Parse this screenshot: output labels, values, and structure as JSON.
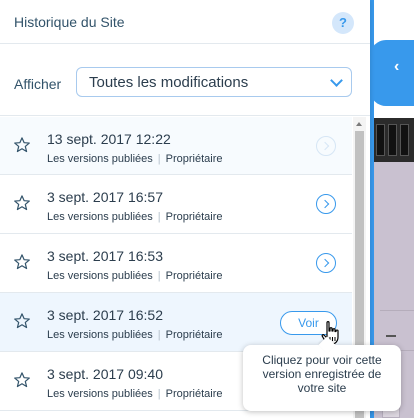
{
  "header": {
    "title": "Historique du Site",
    "help_label": "?"
  },
  "filter": {
    "label": "Afficher",
    "selected": "Toutes les modifications"
  },
  "rows": [
    {
      "date": "13 sept. 2017 12:22",
      "type": "Les versions publiées",
      "owner": "Propriétaire"
    },
    {
      "date": "3 sept. 2017 16:57",
      "type": "Les versions publiées",
      "owner": "Propriétaire"
    },
    {
      "date": "3 sept. 2017 16:53",
      "type": "Les versions publiées",
      "owner": "Propriétaire"
    },
    {
      "date": "3 sept. 2017 16:52",
      "type": "Les versions publiées",
      "owner": "Propriétaire",
      "button": "Voir"
    },
    {
      "date": "3 sept. 2017 09:40",
      "type": "Les versions publiées",
      "owner": "Propriétaire"
    }
  ],
  "tooltip": {
    "text": "Cliquez pour voir cette version enregistrée de votre site"
  },
  "colors": {
    "accent": "#3899ec",
    "text": "#2b3d4d",
    "hover_row": "#eef6fe"
  }
}
